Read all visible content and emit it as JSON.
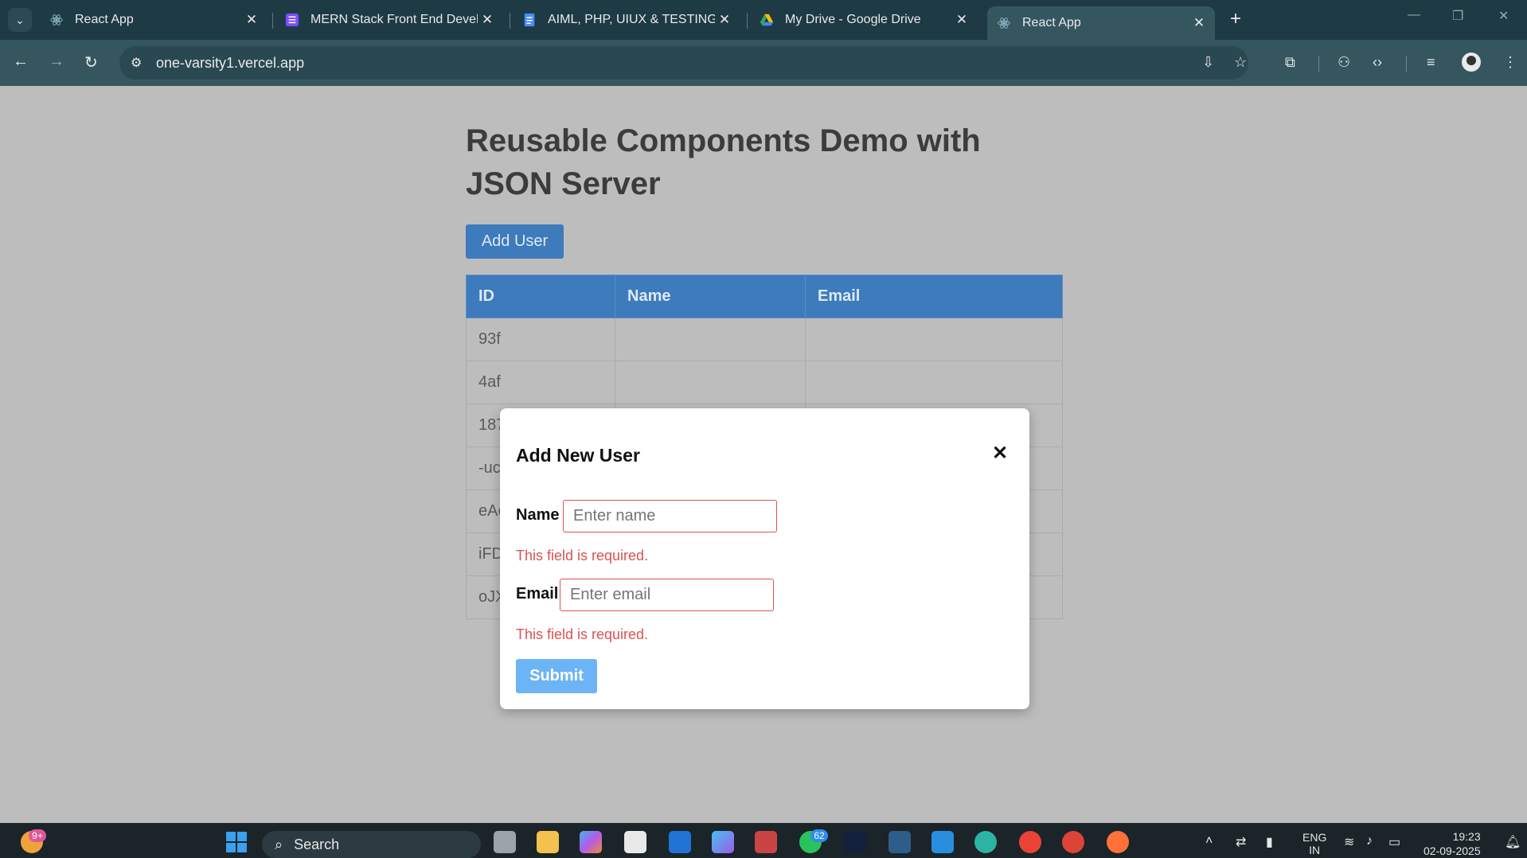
{
  "tabs": [
    {
      "title": "React App",
      "close": "✕"
    },
    {
      "title": "MERN Stack Front End Develop",
      "close": "✕"
    },
    {
      "title": "AIML, PHP, UIUX & TESTING_In",
      "close": "✕"
    },
    {
      "title": "My Drive - Google Drive",
      "close": "✕"
    },
    {
      "title": "React App",
      "close": "✕"
    }
  ],
  "toolbar": {
    "url": "one-varsity1.vercel.app"
  },
  "page": {
    "title": "Reusable Components Demo with JSON Server",
    "add_user_label": "Add User",
    "table": {
      "headers": [
        "ID",
        "Name",
        "Email"
      ],
      "rows": [
        {
          "id": "93f"
        },
        {
          "id": "4af"
        },
        {
          "id": "187"
        },
        {
          "id": "-uc"
        },
        {
          "id": "eAc"
        },
        {
          "id": "iFD"
        },
        {
          "id": "oJX"
        }
      ]
    }
  },
  "modal": {
    "title": "Add New User",
    "close_glyph": "✕",
    "name_label": "Name",
    "name_placeholder": "Enter name",
    "name_error": "This field is required.",
    "email_label": "Email",
    "email_placeholder": "Enter email",
    "email_error": "This field is required.",
    "submit_label": "Submit"
  },
  "taskbar": {
    "search_label": "Search",
    "weather_badge": "9+",
    "whatsapp_badge": "62",
    "lang_line1": "ENG",
    "lang_line2": "IN",
    "time": "19:23",
    "date": "02-09-2025"
  },
  "colors": {
    "accent_blue": "#3d7bbd",
    "submit_blue": "#6cb4f5",
    "error_red": "#d9534f",
    "overlay_gray": "#bdbdbd"
  }
}
